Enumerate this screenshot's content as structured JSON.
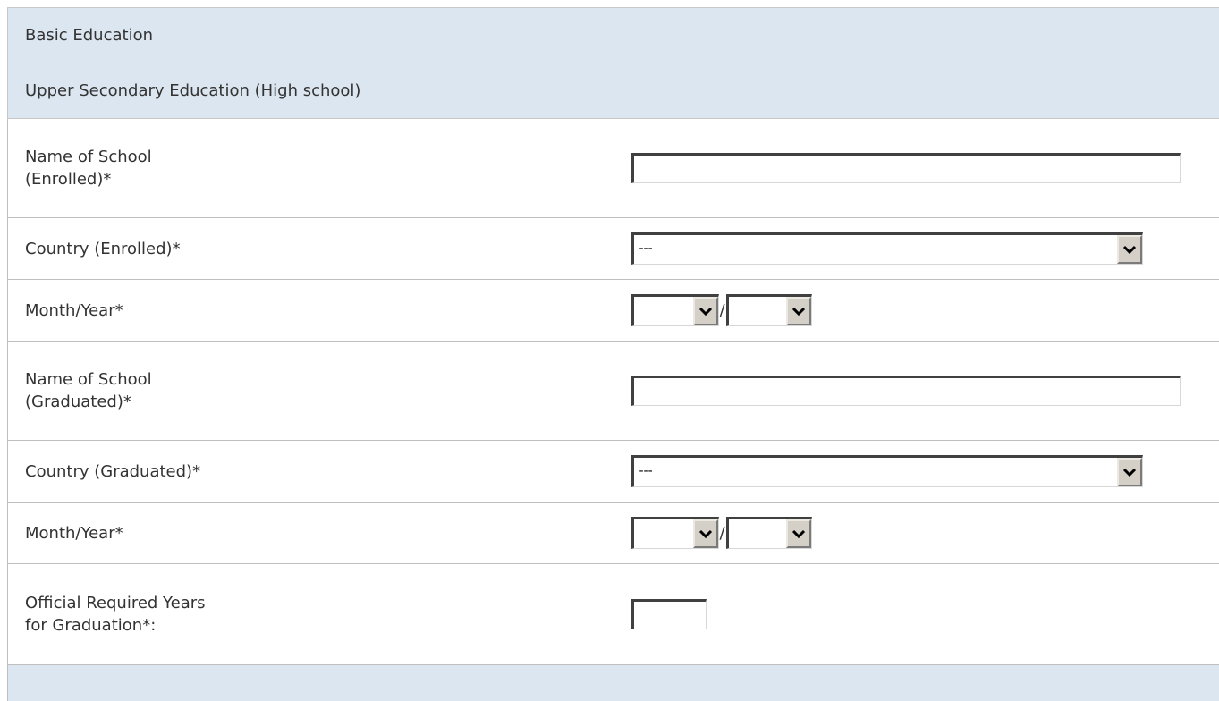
{
  "form": {
    "section_title": "Basic Education",
    "subsection_title": "Upper Secondary Education (High school)",
    "fields": {
      "school_enrolled": {
        "label_line1": "Name of School",
        "label_line2": "(Enrolled)*",
        "value": ""
      },
      "country_enrolled": {
        "label": "Country (Enrolled)*",
        "selected": "---"
      },
      "date_enrolled": {
        "label": "Month/Year*",
        "month": "",
        "year": "",
        "separator": "/"
      },
      "school_graduated": {
        "label_line1": "Name of School",
        "label_line2": "(Graduated)*",
        "value": ""
      },
      "country_graduated": {
        "label": "Country (Graduated)*",
        "selected": "---"
      },
      "date_graduated": {
        "label": "Month/Year*",
        "month": "",
        "year": "",
        "separator": "/"
      },
      "required_years": {
        "label_line1": "Official Required Years",
        "label_line2": "for Graduation*:",
        "value": ""
      }
    }
  },
  "icons": {
    "dropdown": "chevron-down-icon"
  }
}
